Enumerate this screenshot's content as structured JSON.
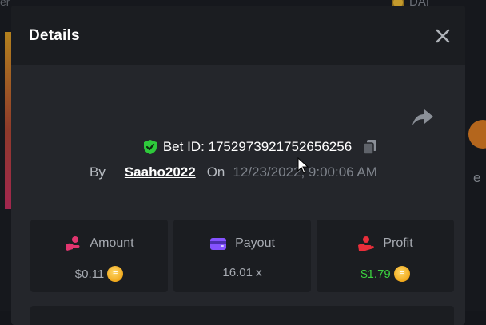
{
  "background": {
    "top_left_text": "er",
    "top_right_text": "DAI",
    "right_letter": "e",
    "colors": {
      "strip": "#b3811e",
      "orb": "#b4661d"
    }
  },
  "modal": {
    "title": "Details",
    "close_icon": "close-icon",
    "share_icon": "share-icon",
    "bet": {
      "label": "Bet ID: 1752973921752656256",
      "verified_icon": "shield-check-icon",
      "copy_icon": "copy-icon"
    },
    "by_label": "By",
    "user": "Saaho2022",
    "on_label": "On",
    "date": "12/23/2022, 9:00:06 AM",
    "cards": [
      {
        "name": "amount",
        "label": "Amount",
        "icon": "hand-coins-icon",
        "value": "$0.11",
        "has_coin": true,
        "coin_symbol": "≡",
        "color": "#e2356f"
      },
      {
        "name": "payout",
        "label": "Payout",
        "icon": "wallet-icon",
        "value": "16.01 x",
        "has_coin": false,
        "color": "#8552ff"
      },
      {
        "name": "profit",
        "label": "Profit",
        "icon": "hand-profit-icon",
        "value": "$1.79",
        "has_coin": true,
        "coin_symbol": "≡",
        "color": "#ea2e3a"
      }
    ]
  },
  "colors": {
    "profit_text": "#3bd03f",
    "verified": "#2ec93b",
    "coin": "#f1a91c"
  }
}
